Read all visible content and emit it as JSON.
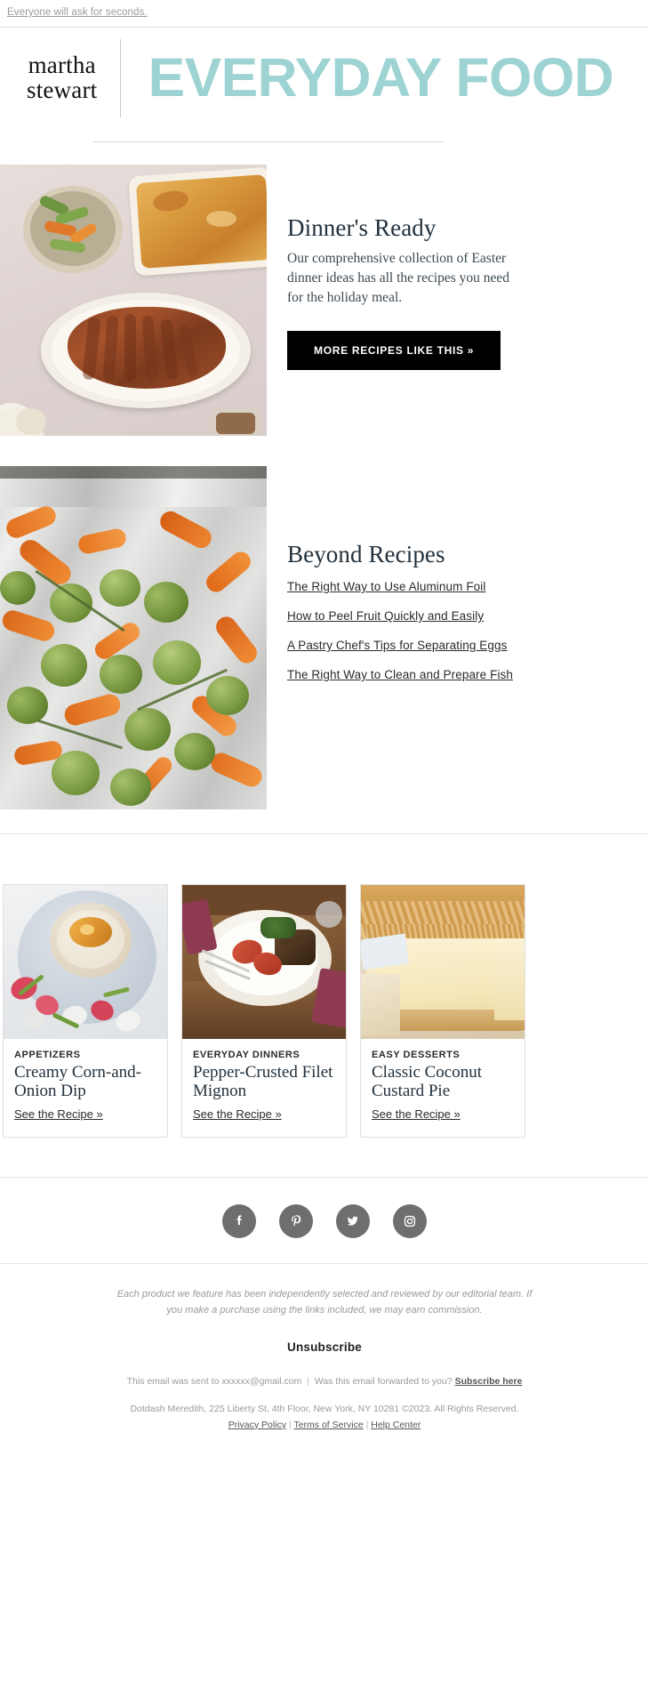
{
  "preheader": {
    "text": "Everyone will ask for seconds."
  },
  "masthead": {
    "brand_line1": "martha",
    "brand_line2": "stewart",
    "publication": "EVERYDAY FOOD",
    "accent_color": "#9ed3d3"
  },
  "features": [
    {
      "heading": "Dinner's Ready",
      "body": "Our comprehensive collection of Easter dinner ideas has all the recipes you need for the holiday meal.",
      "cta_label": "MORE RECIPES LIKE THIS »",
      "image_alt": "glazed spiral ham with potato gratin and vegetables"
    },
    {
      "heading": "Beyond Recipes",
      "links": [
        "The Right Way to Use Aluminum Foil",
        "How to Peel Fruit Quickly and Easily",
        "A Pastry Chef's Tips for Separating Eggs",
        "The Right Way to Clean and Prepare Fish"
      ],
      "image_alt": "sheet pan of roasted brussels sprouts and carrots"
    }
  ],
  "cards": [
    {
      "kicker": "APPETIZERS",
      "title": "Creamy Corn-and-Onion Dip",
      "link_label": "See the Recipe »",
      "image_alt": "bowl of creamy corn dip with radishes"
    },
    {
      "kicker": "EVERYDAY DINNERS",
      "title": "Pepper-Crusted Filet Mignon",
      "link_label": "See the Recipe »",
      "image_alt": "filet mignon plated with tomatoes and spinach"
    },
    {
      "kicker": "EASY DESSERTS",
      "title": "Classic Coconut Custard Pie",
      "link_label": "See the Recipe »",
      "image_alt": "slice of coconut custard pie"
    }
  ],
  "social": {
    "icon_color": "#6e6e6e",
    "items": [
      {
        "name": "facebook-icon",
        "label": "Facebook"
      },
      {
        "name": "pinterest-icon",
        "label": "Pinterest"
      },
      {
        "name": "twitter-icon",
        "label": "Twitter"
      },
      {
        "name": "instagram-icon",
        "label": "Instagram"
      }
    ]
  },
  "footer": {
    "disclaimer": "Each product we feature has been independently selected and reviewed by our editorial team. If you make a purchase using the links included, we may earn commission.",
    "unsubscribe_label": "Unsubscribe",
    "sent_prefix": "This email was sent to ",
    "sent_email": "xxxxxx@gmail.com",
    "forwarded_question": "Was this email forwarded to you?",
    "subscribe_label": "Subscribe here",
    "address": "Dotdash Meredith, 225 Liberty St, 4th Floor, New York, NY 10281 ©2023. All Rights Reserved.",
    "privacy_label": "Privacy Policy",
    "terms_label": "Terms of Service",
    "help_label": "Help Center",
    "pipe": "|"
  }
}
